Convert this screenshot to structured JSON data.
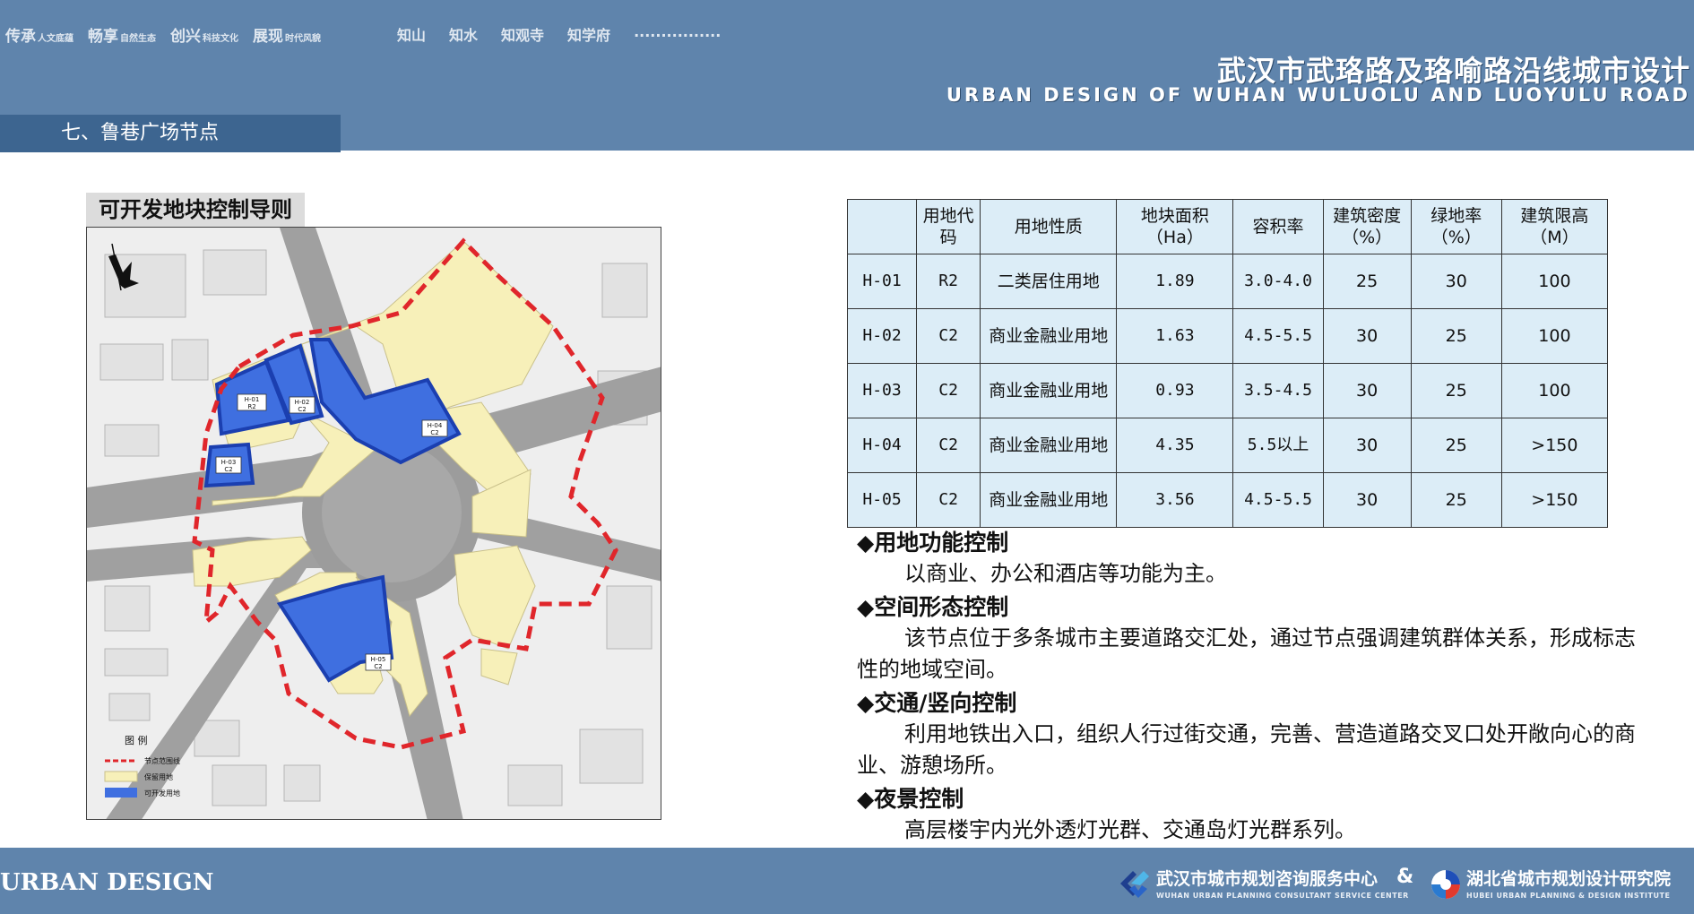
{
  "header": {
    "nav_items": [
      {
        "main": "传承",
        "sub": "人文底蕴"
      },
      {
        "main": "畅享",
        "sub": "自然生态"
      },
      {
        "main": "创兴",
        "sub": "科技文化"
      },
      {
        "main": "展现",
        "sub": "时代风貌"
      }
    ],
    "nav_right": [
      "知山",
      "知水",
      "知观寺",
      "知学府",
      "................"
    ],
    "title": "武汉市武珞路及珞喻路沿线城市设计",
    "subtitle": "URBAN DESIGN OF WUHAN WULUOLU AND LUOYULU ROAD",
    "section": "七、鲁巷广场节点"
  },
  "map": {
    "heading": "可开发地块控制导则",
    "legend_title": "图 例",
    "legend": [
      {
        "label": "节点范围线",
        "color": "#e0262b"
      },
      {
        "label": "保留用地",
        "color": "#f7f0b9"
      },
      {
        "label": "可开发用地",
        "color": "#3f6fe0"
      }
    ],
    "parcels": [
      {
        "id": "H-01",
        "code": "R2"
      },
      {
        "id": "H-02",
        "code": "C2"
      },
      {
        "id": "H-03",
        "code": "C2"
      },
      {
        "id": "H-04",
        "code": "C2"
      },
      {
        "id": "H-05",
        "code": "C2"
      }
    ]
  },
  "table": {
    "headers": [
      "",
      "用地代码",
      "用地性质",
      "地块面积（Ha）",
      "容积率",
      "建筑密度（%）",
      "绿地率（%）",
      "建筑限高（M）"
    ],
    "rows": [
      [
        "H-01",
        "R2",
        "二类居住用地",
        "1.89",
        "3.0-4.0",
        "25",
        "30",
        "100"
      ],
      [
        "H-02",
        "C2",
        "商业金融业用地",
        "1.63",
        "4.5-5.5",
        "30",
        "25",
        "100"
      ],
      [
        "H-03",
        "C2",
        "商业金融业用地",
        "0.93",
        "3.5-4.5",
        "30",
        "25",
        "100"
      ],
      [
        "H-04",
        "C2",
        "商业金融业用地",
        "4.35",
        "5.5以上",
        "30",
        "25",
        ">150"
      ],
      [
        "H-05",
        "C2",
        "商业金融业用地",
        "3.56",
        "4.5-5.5",
        "30",
        "25",
        ">150"
      ]
    ]
  },
  "guidelines": [
    {
      "title": "◆用地功能控制",
      "body": "以商业、办公和酒店等功能为主。"
    },
    {
      "title": "◆空间形态控制",
      "body": "该节点位于多条城市主要道路交汇处，通过节点强调建筑群体关系，形成标志性的地域空间。"
    },
    {
      "title": "◆交通/竖向控制",
      "body": "利用地铁出入口，组织人行过街交通，完善、营造道路交叉口处开敞向心的商业、游憩场所。"
    },
    {
      "title": "◆夜景控制",
      "body": "高层楼宇内光外透灯光群、交通岛灯光群系列。"
    }
  ],
  "footer": {
    "brand": "URBAN  DESIGN",
    "org1_name": "武汉市城市规划咨询服务中心",
    "org1_en": "WUHAN URBAN PLANNING CONSULTANT SERVICE CENTER",
    "amp": "&",
    "org2_name": "湖北省城市规划设计研究院",
    "org2_en": "HUBEI URBAN PLANNING & DESIGN INSTITUTE"
  },
  "colors": {
    "header_bg": "#5f84ac",
    "tab_bg": "#3d6590",
    "table_bg": "#dcedf7",
    "boundary": "#e0262b",
    "retained": "#f7f0b9",
    "developable": "#3f6fe0"
  }
}
